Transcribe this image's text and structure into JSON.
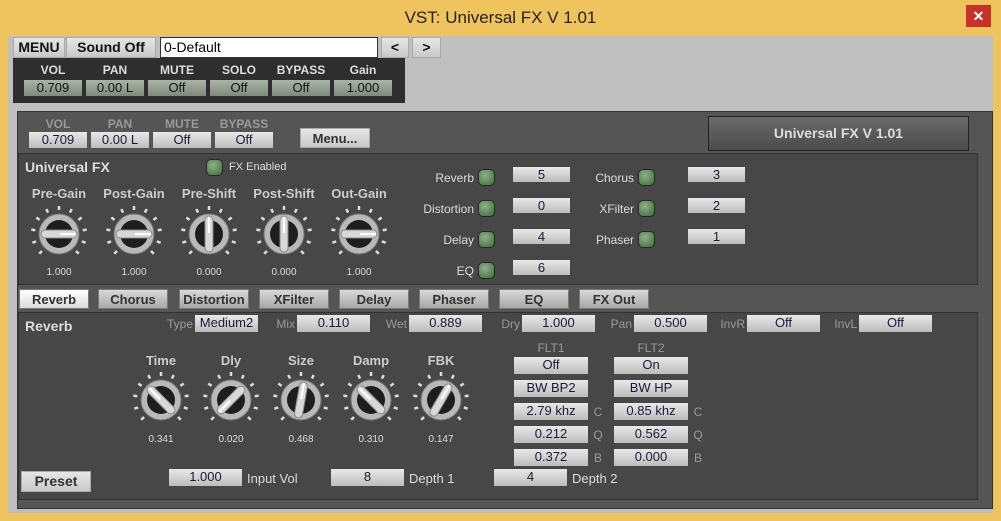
{
  "window": {
    "title": "VST: Universal FX V 1.01",
    "close": "✕"
  },
  "toolbar": {
    "menu": "MENU",
    "sound_off": "Sound Off",
    "preset": "0-Default",
    "prev": "<",
    "next": ">"
  },
  "host_mix": [
    {
      "label": "VOL",
      "value": "0.709"
    },
    {
      "label": "PAN",
      "value": "0.00 L"
    },
    {
      "label": "MUTE",
      "value": "Off"
    },
    {
      "label": "SOLO",
      "value": "Off"
    },
    {
      "label": "BYPASS",
      "value": "Off"
    },
    {
      "label": "Gain",
      "value": "1.000"
    }
  ],
  "plugin_mix": [
    {
      "label": "VOL",
      "value": "0.709"
    },
    {
      "label": "PAN",
      "value": "0.00 L"
    },
    {
      "label": "MUTE",
      "value": "Off"
    },
    {
      "label": "BYPASS",
      "value": "Off"
    }
  ],
  "plugin_menu": "Menu...",
  "plugin_name": "Universal FX V 1.01",
  "ufx": {
    "title": "Universal FX",
    "fx_enabled": "FX Enabled",
    "knobs": [
      {
        "label": "Pre-Gain",
        "value": "1.000"
      },
      {
        "label": "Post-Gain",
        "value": "1.000"
      },
      {
        "label": "Pre-Shift",
        "value": "0.000"
      },
      {
        "label": "Post-Shift",
        "value": "0.000"
      },
      {
        "label": "Out-Gain",
        "value": "1.000"
      }
    ],
    "order": [
      {
        "label": "Reverb",
        "value": "5"
      },
      {
        "label": "Distortion",
        "value": "0"
      },
      {
        "label": "Delay",
        "value": "4"
      },
      {
        "label": "EQ",
        "value": "6"
      },
      {
        "label": "Chorus",
        "value": "3"
      },
      {
        "label": "XFilter",
        "value": "2"
      },
      {
        "label": "Phaser",
        "value": "1"
      }
    ]
  },
  "tabs": [
    "Reverb",
    "Chorus",
    "Distortion",
    "XFilter",
    "Delay",
    "Phaser",
    "EQ",
    "FX Out"
  ],
  "reverb": {
    "title": "Reverb",
    "params": [
      {
        "label": "Type",
        "value": "Medium2"
      },
      {
        "label": "Mix",
        "value": "0.110"
      },
      {
        "label": "Wet",
        "value": "0.889"
      },
      {
        "label": "Dry",
        "value": "1.000"
      },
      {
        "label": "Pan",
        "value": "0.500"
      },
      {
        "label": "InvR",
        "value": "Off"
      },
      {
        "label": "InvL",
        "value": "Off"
      }
    ],
    "knobs": [
      {
        "label": "Time",
        "value": "0.341"
      },
      {
        "label": "Dly",
        "value": "0.020"
      },
      {
        "label": "Size",
        "value": "0.468"
      },
      {
        "label": "Damp",
        "value": "0.310"
      },
      {
        "label": "FBK",
        "value": "0.147"
      }
    ],
    "flt1": {
      "title": "FLT1",
      "state": "Off",
      "type": "BW BP2",
      "c": "2.79 khz",
      "q": "0.212",
      "b": "0.372"
    },
    "flt2": {
      "title": "FLT2",
      "state": "On",
      "type": "BW HP",
      "c": "0.85 khz",
      "q": "0.562",
      "b": "0.000"
    },
    "flt_labels": {
      "c": "C",
      "q": "Q",
      "b": "B"
    },
    "preset": "Preset",
    "input_vol": {
      "label": "Input Vol",
      "value": "1.000"
    },
    "depth1": {
      "label": "Depth 1",
      "value": "8"
    },
    "depth2": {
      "label": "Depth 2",
      "value": "4"
    }
  }
}
